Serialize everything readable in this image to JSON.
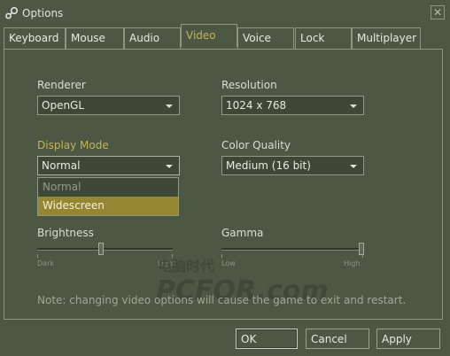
{
  "window": {
    "title": "Options",
    "close_glyph": "✕"
  },
  "tabs": [
    {
      "label": "Keyboard",
      "active": false
    },
    {
      "label": "Mouse",
      "active": false
    },
    {
      "label": "Audio",
      "active": false
    },
    {
      "label": "Video",
      "active": true
    },
    {
      "label": "Voice",
      "active": false
    },
    {
      "label": "Lock",
      "active": false
    },
    {
      "label": "Multiplayer",
      "active": false
    }
  ],
  "renderer": {
    "label": "Renderer",
    "value": "OpenGL"
  },
  "resolution": {
    "label": "Resolution",
    "value": "1024 x 768"
  },
  "display_mode": {
    "label": "Display Mode",
    "value": "Normal",
    "options": [
      "Normal",
      "Widescreen"
    ],
    "highlighted": "Widescreen"
  },
  "color_quality": {
    "label": "Color Quality",
    "value": "Medium (16 bit)"
  },
  "brightness": {
    "label": "Brightness",
    "min_label": "Dark",
    "max_label": "Light",
    "level": 0.45
  },
  "gamma": {
    "label": "Gamma",
    "min_label": "Low",
    "max_label": "High",
    "level": 1.0
  },
  "note": "Note: changing video options will cause the game to exit and restart.",
  "buttons": {
    "ok": "OK",
    "cancel": "Cancel",
    "apply": "Apply"
  },
  "watermark": {
    "line1": "电脑时代",
    "line2": "PCFOR.com"
  },
  "colors": {
    "background": "#4c5844",
    "accent": "#c4b550",
    "selection": "#958731"
  }
}
